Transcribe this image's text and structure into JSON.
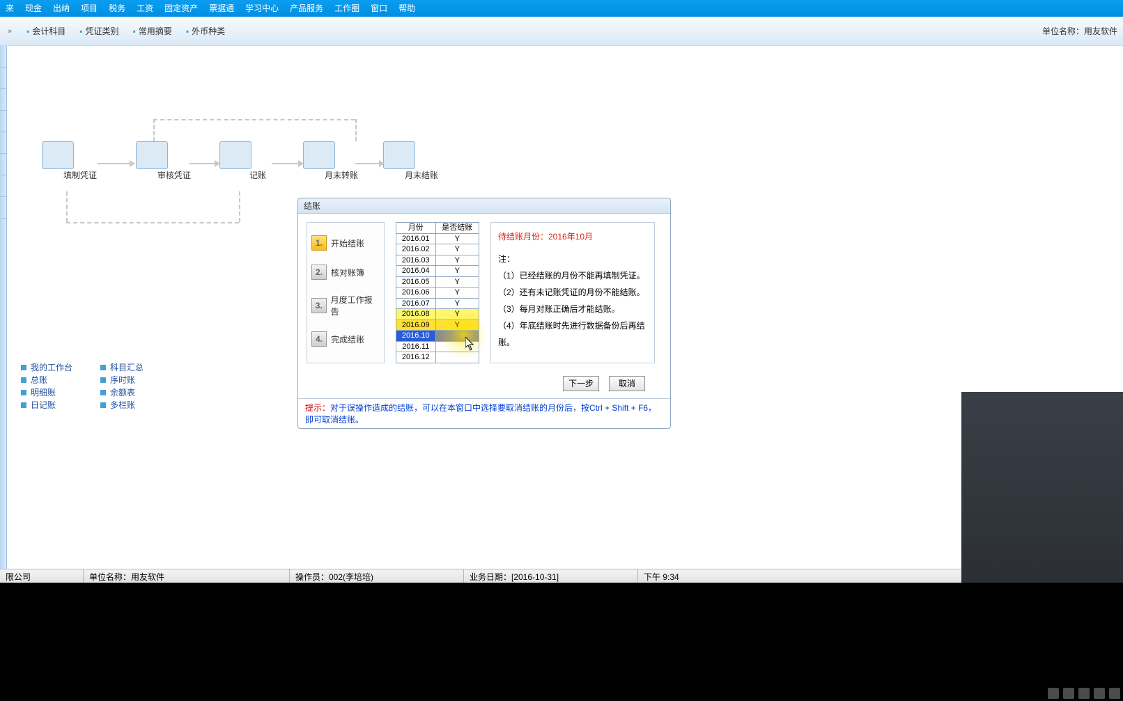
{
  "menu": [
    "来",
    "现金",
    "出纳",
    "项目",
    "税务",
    "工资",
    "固定资产",
    "票据通",
    "学习中心",
    "产品服务",
    "工作圈",
    "窗口",
    "帮助"
  ],
  "toolbar": {
    "items": [
      "会计科目",
      "凭证类别",
      "常用摘要",
      "外币种类"
    ],
    "unit_label": "单位名称：用友软件"
  },
  "workflow": {
    "items": [
      "填制凭证",
      "审核凭证",
      "记账",
      "月末转账",
      "月末结账"
    ]
  },
  "links": {
    "col1": [
      "我的工作台",
      "总账",
      "明细账",
      "日记账"
    ],
    "col2": [
      "科目汇总",
      "序时账",
      "余额表",
      "多栏账"
    ]
  },
  "dialog": {
    "title": "结账",
    "steps": [
      "开始结账",
      "核对账簿",
      "月度工作报告",
      "完成结账"
    ],
    "table": {
      "headers": [
        "月份",
        "是否结账"
      ],
      "rows": [
        {
          "m": "2016.01",
          "s": "Y"
        },
        {
          "m": "2016.02",
          "s": "Y"
        },
        {
          "m": "2016.03",
          "s": "Y"
        },
        {
          "m": "2016.04",
          "s": "Y"
        },
        {
          "m": "2016.05",
          "s": "Y"
        },
        {
          "m": "2016.06",
          "s": "Y"
        },
        {
          "m": "2016.07",
          "s": "Y"
        },
        {
          "m": "2016.08",
          "s": "Y"
        },
        {
          "m": "2016.09",
          "s": "Y"
        },
        {
          "m": "2016.10",
          "s": ""
        },
        {
          "m": "2016.11",
          "s": ""
        },
        {
          "m": "2016.12",
          "s": ""
        }
      ]
    },
    "pending": "待结账月份：2016年10月",
    "note_head": "注：",
    "notes": [
      "（1）已经结账的月份不能再填制凭证。",
      "（2）还有未记账凭证的月份不能结账。",
      "（3）每月对账正确后才能结账。",
      "（4）年底结账时先进行数据备份后再结账。"
    ],
    "btn_next": "下一步",
    "btn_cancel": "取消",
    "tip_label": "提示：",
    "tip_body": "对于误操作造成的结账，可以在本窗口中选择要取消结账的月份后，按Ctrl + Shift + F6，即可取消结账。"
  },
  "status": {
    "company": "限公司",
    "unit": "单位名称：用友软件",
    "operator": "操作员：002(李培培)",
    "bizdate": "业务日期：[2016-10-31]",
    "time": "下午 9:34"
  }
}
